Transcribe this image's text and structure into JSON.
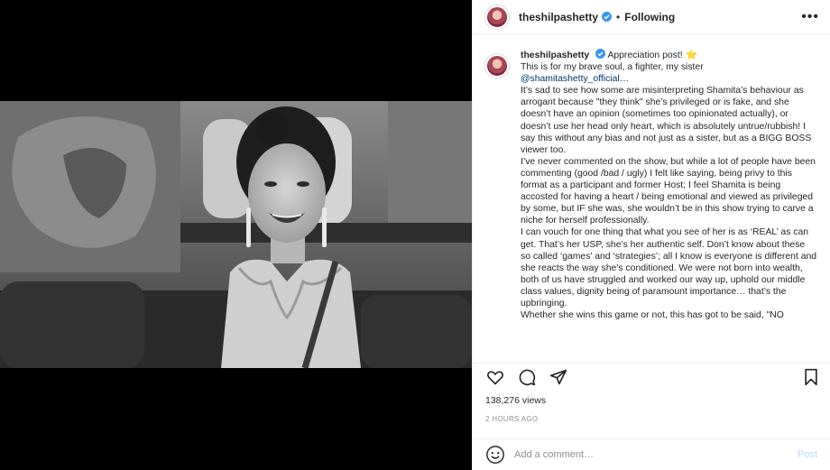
{
  "header": {
    "username": "theshilpashetty",
    "separator": "•",
    "follow_status": "Following",
    "more_label": "•••"
  },
  "caption": {
    "username": "theshilpashetty",
    "first_line": "Appreciation post!",
    "star": "⭐",
    "line2": "This is for my brave soul, a fighter, my sister",
    "mention": "@shamitashetty_official",
    "mention_suffix": "…",
    "p1": "It’s sad to see how some are misinterpreting Shamita’s behaviour as arrogant because \"they think\" she’s privileged or is fake, and she doesn’t have an opinion (sometimes too opinionated actually), or doesn’t use her head only heart, which is absolutely untrue/rubbish! I say this without any bias and not just as a sister, but as a BIGG BOSS viewer too.",
    "p2": "I’ve never commented on the show, but while a lot of people have been commenting (good /bad / ugly) I felt like saying, being privy to this format as a participant and former Host; I feel Shamita is being accosted for having a heart / being emotional and viewed as privileged by some, but IF she was, she wouldn’t be in this show trying to carve a niche for herself professionally.",
    "p3": "I can vouch for one thing that what you see of her is as ‘REAL’ as can get. That’s her USP, she’s her authentic self. Don’t know about these so called ‘games’ and ‘strategies’; all I know is everyone is different and she reacts the way she’s conditioned. We were not born into wealth, both of us have struggled and worked our way up, uphold our middle class values, dignity being of paramount importance… that’s the upbringing.",
    "p4": "Whether she wins this game or not, this has got to be said, \"NO"
  },
  "actions": {
    "like_icon": "heart-icon",
    "comment_icon": "comment-icon",
    "share_icon": "share-icon",
    "save_icon": "bookmark-icon"
  },
  "stats": {
    "views": "138,276 views",
    "timestamp": "2 HOURS AGO"
  },
  "comment": {
    "placeholder": "Add a comment…",
    "post_label": "Post"
  },
  "colors": {
    "verified": "#3897f0",
    "mention": "#00376b",
    "post_disabled": "#b2dffc",
    "muted": "#8e8e8e"
  }
}
